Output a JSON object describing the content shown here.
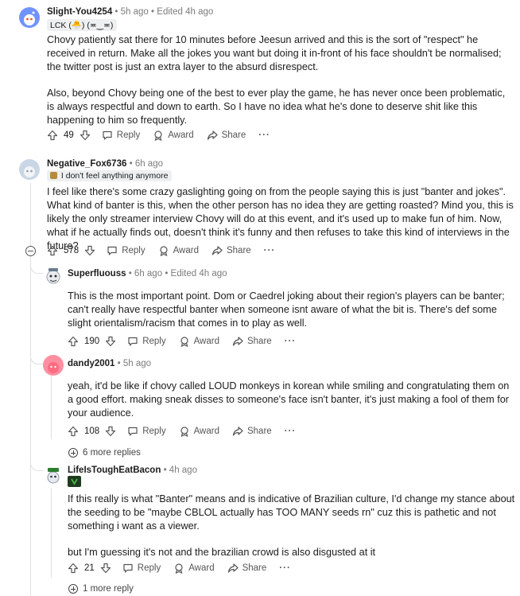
{
  "comments": [
    {
      "author": "Slight-You4254",
      "time": "5h ago",
      "edited": "Edited 4h ago",
      "flair": "LCK (🐣) (≖‿≖)",
      "paragraphs": [
        "Chovy patiently sat there for 10 minutes before Jeesun arrived and this is the sort of \"respect\" he received in return. Make all the jokes you want but doing it in-front of his face shouldn't be normalised; the twitter post is just an extra layer to the absurd disrespect.",
        "Also, beyond Chovy being one of the best to ever play the game, he has never once been problematic, is always respectful and down to earth. So I have no idea what he's done to deserve shit like this happening to him so frequently."
      ],
      "votes": "49",
      "reply": "Reply",
      "award": "Award",
      "share": "Share",
      "more": "···",
      "avatar_color": "#7193ff"
    },
    {
      "author": "Negative_Fox6736",
      "time": "6h ago",
      "flair": "I don't feel anything anymore",
      "paragraphs": [
        "I feel like there's some crazy gaslighting going on from the people saying this is just \"banter and jokes\". What kind of banter is this, when the other person has no idea they are getting roasted? Mind you, this is likely the only streamer interview Chovy will do at this event, and it's used up to make fun of him. Now, what if he actually finds out, doesn't think it's funny and then refuses to take this kind of interviews in the future?"
      ],
      "votes": "578",
      "reply": "Reply",
      "award": "Award",
      "share": "Share",
      "more": "···",
      "avatar_color": "#c8d6e5"
    },
    {
      "author": "Superfluouss",
      "time": "6h ago",
      "edited": "Edited 4h ago",
      "paragraphs": [
        "This is the most important point. Dom or Caedrel joking about their region's players can be banter; can't really have respectful banter when someone isnt aware of what the bit is. There's def some slight orientalism/racism that comes in to play as well."
      ],
      "votes": "190",
      "reply": "Reply",
      "award": "Award",
      "share": "Share",
      "more": "···"
    },
    {
      "author": "dandy2001",
      "time": "5h ago",
      "paragraphs": [
        "yeah, it'd be like if chovy called LOUD monkeys in korean while smiling and congratulating them on a good effort. making sneak disses to someone's face isn't banter, it's just making a fool of them for your audience."
      ],
      "votes": "108",
      "reply": "Reply",
      "award": "Award",
      "share": "Share",
      "more": "···",
      "avatar_color": "#ff6b81"
    },
    {
      "author": "LifeIsToughEatBacon",
      "time": "4h ago",
      "paragraphs": [
        "If this really is what \"Banter\" means and is indicative of Brazilian culture, I'd change my stance about the seeding to be \"maybe CBLOL actually has TOO MANY seeds rn\" cuz this is pathetic and not something i want as a viewer.",
        "but I'm guessing it's not and the brazilian crowd is also disgusted at it"
      ],
      "votes": "21",
      "reply": "Reply",
      "award": "Award",
      "share": "Share",
      "more": "···"
    }
  ],
  "more_replies_1": "6 more replies",
  "more_replies_2": "1 more reply",
  "dot": "•"
}
